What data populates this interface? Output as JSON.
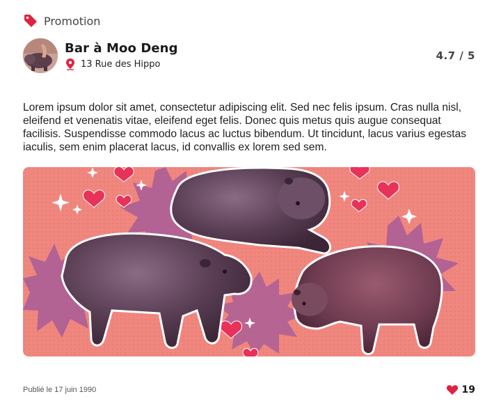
{
  "post": {
    "category": "Promotion",
    "venue_name": "Bar à Moo Deng",
    "address": "13 Rue des Hippo",
    "rating": "4.7 / 5",
    "description": "Lorem ipsum dolor sit amet, consectetur adipiscing elit. Sed nec felis ipsum. Cras nulla nisl, eleifend et venenatis vitae, eleifend eget felis. Donec quis metus quis augue consequat facilisis. Suspendisse commodo lacus ac luctus bibendum. Ut tincidunt, lacus varius egestas iaculis, sem enim placerat lacus, id convallis ex lorem sed sem.",
    "published": "Publié le 17 juin 1990",
    "likes": "19"
  },
  "colors": {
    "accent": "#e0233f",
    "banner_bg": "#f0867e",
    "banner_burst": "#a05a98"
  },
  "icons": {
    "tag": "tag-icon",
    "pin": "map-pin-icon",
    "like": "heart-icon"
  }
}
